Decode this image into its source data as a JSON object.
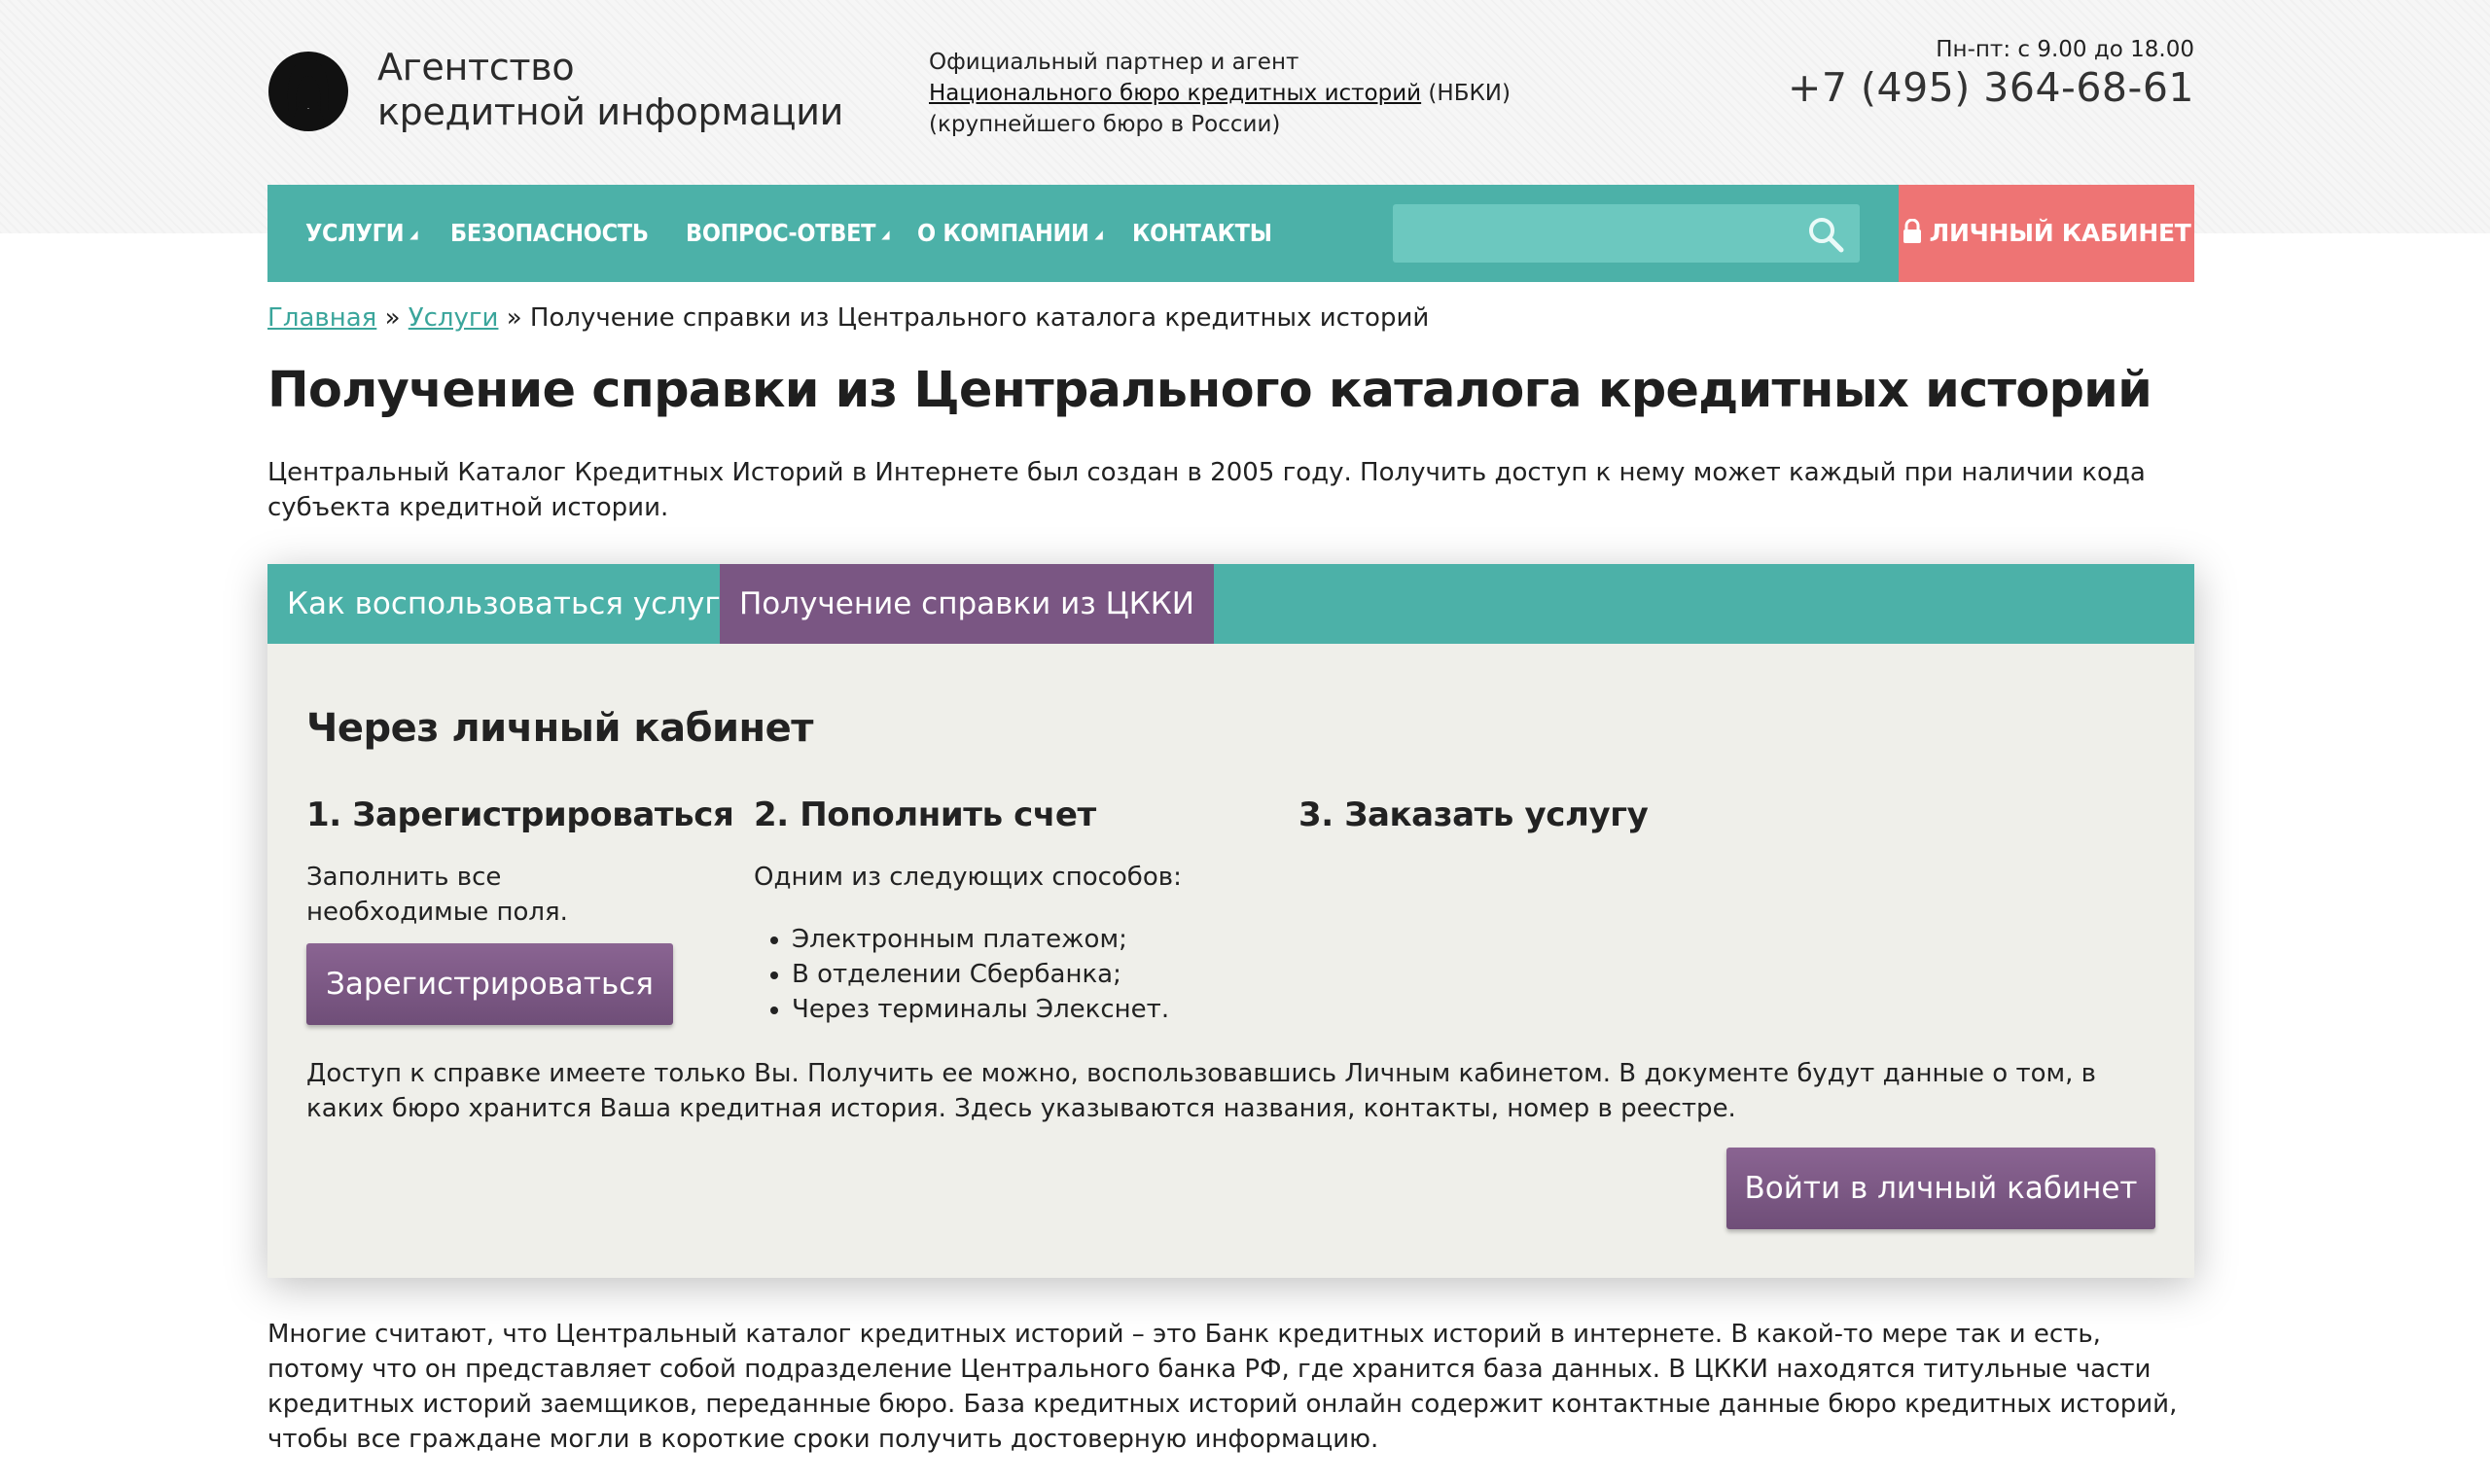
{
  "header": {
    "logo_line1": "Агентство",
    "logo_line2": "кредитной информации",
    "partner_line1": "Официальный партнер и агент",
    "partner_link": "Национального бюро кредитных историй",
    "partner_abbr": " (НБКИ)",
    "partner_line3": "(крупнейшего бюро в России)",
    "hours": "Пн-пт: с 9.00 до 18.00",
    "phone": "+7 (495) 364-68-61"
  },
  "nav": {
    "items": [
      {
        "label": "Услуги",
        "dropdown": true
      },
      {
        "label": "Безопасность",
        "dropdown": false
      },
      {
        "label": "Вопрос-ответ",
        "dropdown": true
      },
      {
        "label": "О компании",
        "dropdown": true
      },
      {
        "label": "Контакты",
        "dropdown": false
      }
    ],
    "search_placeholder": "",
    "cabinet_label": "Личный кабинет"
  },
  "breadcrumb": {
    "home": "Главная",
    "sep": " » ",
    "services": "Услуги",
    "current": "Получение справки из Центрального каталога кредитных историй"
  },
  "page": {
    "title": "Получение справки из Центрального каталога кредитных историй",
    "intro": "Центральный Каталог Кредитных Историй в Интернете был создан в 2005 году. Получить доступ к нему может каждый при наличии кода субъекта кредитной истории."
  },
  "tabs": [
    {
      "label": "Как воспользоваться услугой",
      "active": false
    },
    {
      "label": "Получение справки из ЦККИ",
      "active": true
    }
  ],
  "panel": {
    "title": "Через личный кабинет",
    "step1": {
      "heading": "1. Зарегистрироваться",
      "text": "Заполнить все необходимые поля.",
      "button": "Зарегистрироваться"
    },
    "step2": {
      "heading": "2. Пополнить счет",
      "text": "Одним из следующих способов:",
      "items": [
        "Электронным платежом;",
        "В отделении Сбербанка;",
        "Через терминалы Элекснет."
      ]
    },
    "step3": {
      "heading": "3. Заказать услугу"
    },
    "access_text": "Доступ к справке имеете только Вы. Получить ее можно, воспользовавшись Личным кабинетом. В документе будут данные о том, в каких бюро хранится Ваша кредитная история. Здесь указываются названия, контакты, номер в реестре.",
    "login_button": "Войти в личный кабинет"
  },
  "bottom_text": "Многие считают, что Центральный каталог кредитных историй – это Банк кредитных историй в интернете. В какой-то мере так и есть, потому что он представляет собой подразделение Центрального банка РФ, где хранится база данных. В ЦККИ находятся титульные части кредитных историй заемщиков, переданные бюро. База кредитных историй онлайн содержит контактные данные бюро кредитных историй, чтобы все граждане могли в короткие сроки получить достоверную информацию.",
  "colors": {
    "teal": "#4cb1a8",
    "purple": "#7a5683",
    "coral": "#ee7474",
    "link": "#3aa59b"
  },
  "icons": {
    "logo": "logo-mark-icon",
    "search": "search-icon",
    "lock": "lock-icon"
  }
}
